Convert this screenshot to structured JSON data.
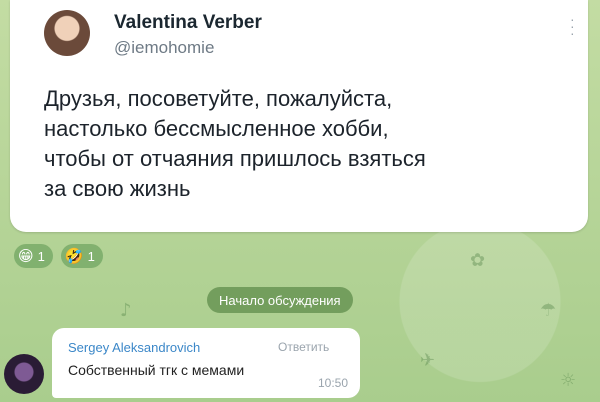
{
  "tweet": {
    "author_name": "Valentina Verber",
    "author_handle": "@iemohomie",
    "text": "Друзья, посоветуйте, пожалуйста,\nнастолько бессмысленное хобби,\nчтобы от отчаяния пришлось взяться\nза свою жизнь"
  },
  "reactions": [
    {
      "emoji": "😁",
      "count": "1"
    },
    {
      "emoji": "🤣",
      "count": "1"
    }
  ],
  "service_message": "Начало обсуждения",
  "comment": {
    "author": "Sergey Aleksandrovich",
    "reply_label": "Ответить",
    "text": "Собственный тгк с мемами",
    "time": "10:50"
  },
  "colors": {
    "background": "#b5d39a",
    "author_link": "#3b87c8"
  }
}
